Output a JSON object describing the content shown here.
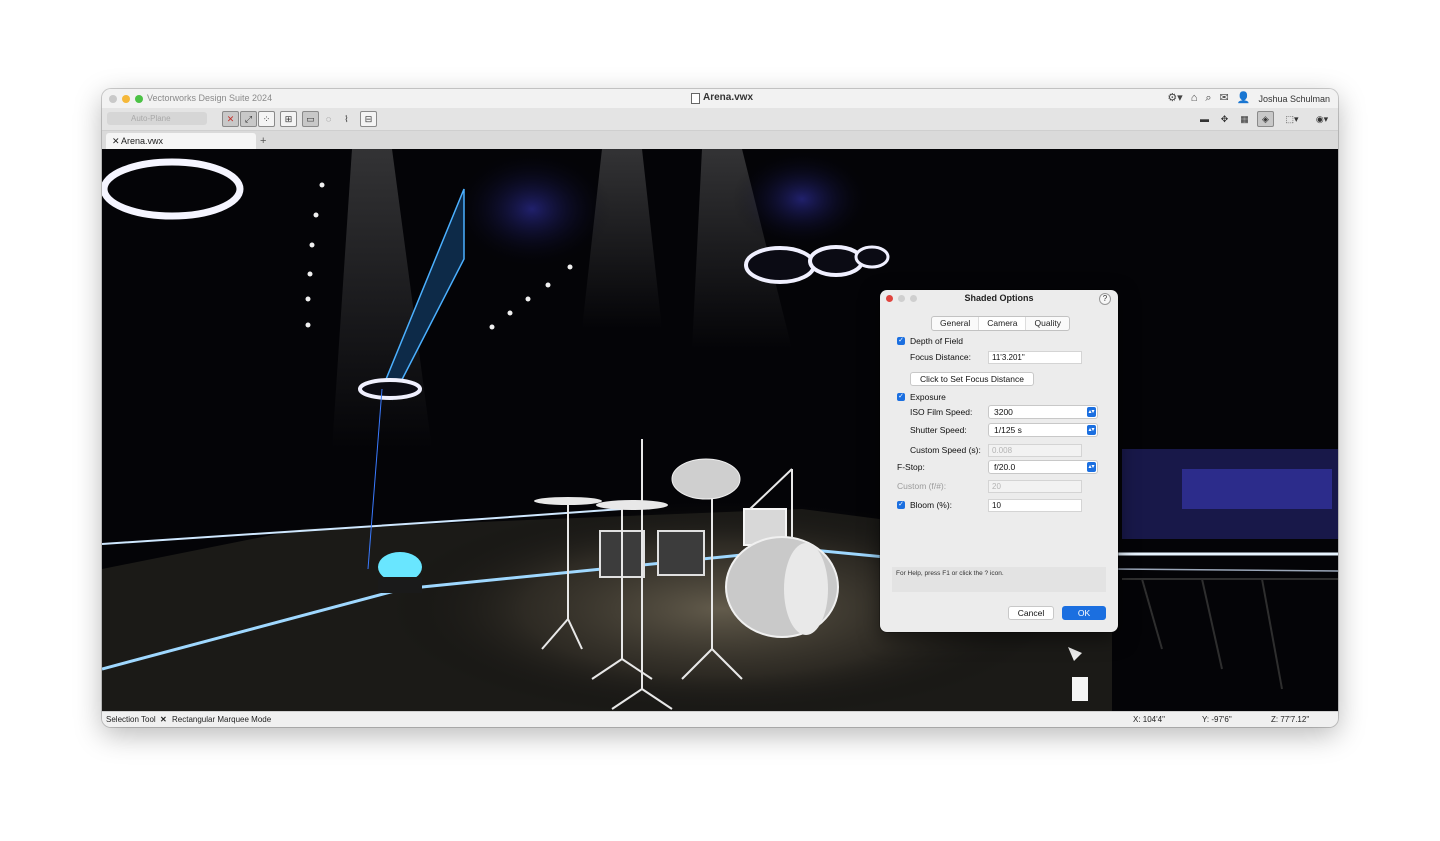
{
  "window": {
    "app_title": "Vectorworks Design Suite 2024",
    "doc_title": "Arena.vwx",
    "user": "Joshua Schulman",
    "icons": [
      "gear-icon",
      "home-icon",
      "search-icon",
      "mail-icon",
      "user-icon"
    ]
  },
  "toolbar": {
    "plane_label": "Auto-Plane",
    "view_icons": [
      "screen-icon",
      "flyover-icon",
      "views-icon",
      "render-icon",
      "projection-icon",
      "globe-icon"
    ]
  },
  "tabs": [
    {
      "close": "✕",
      "label": "Arena.vwx"
    }
  ],
  "tab_add": "+",
  "statusbar": {
    "tool": "Selection Tool",
    "mode_marker": "✕",
    "mode": "Rectangular Marquee Mode",
    "x": "X: 104'4\"",
    "y": "Y: -97'6\"",
    "z": "Z: 77'7.12\""
  },
  "dialog": {
    "title": "Shaded Options",
    "help": "?",
    "tabs": [
      {
        "label": "General",
        "selected": false
      },
      {
        "label": "Camera",
        "selected": true
      },
      {
        "label": "Quality",
        "selected": false
      }
    ],
    "depth_of_field": {
      "label": "Depth of Field",
      "checked": true
    },
    "focus_distance": {
      "label": "Focus Distance:",
      "value": "11'3.201\""
    },
    "set_focus_button": "Click to Set Focus Distance",
    "exposure": {
      "label": "Exposure",
      "checked": true
    },
    "iso": {
      "label": "ISO Film Speed:",
      "value": "3200"
    },
    "shutter": {
      "label": "Shutter Speed:",
      "value": "1/125 s"
    },
    "custom_speed": {
      "label": "Custom Speed (s):",
      "value": "0.008"
    },
    "fstop": {
      "label": "F-Stop:",
      "value": "f/20.0"
    },
    "custom_f": {
      "label": "Custom (f/#):",
      "value": "20"
    },
    "bloom": {
      "label": "Bloom (%):",
      "value": "10",
      "checked": true
    },
    "help_text": "For Help, press F1 or click the ? icon.",
    "cancel": "Cancel",
    "ok": "OK"
  }
}
